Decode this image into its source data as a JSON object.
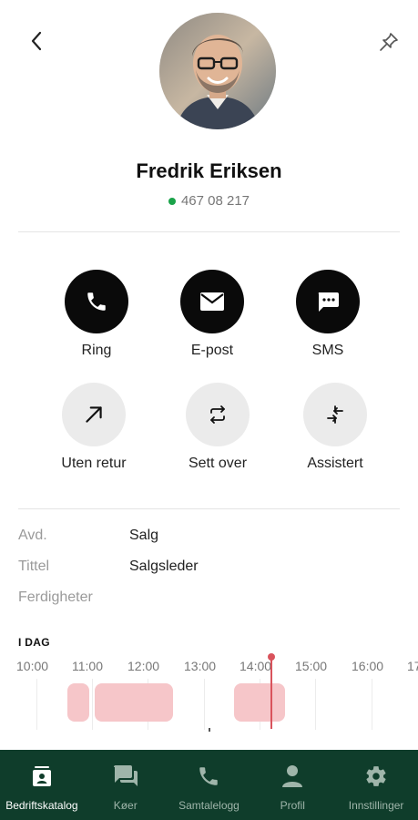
{
  "contact": {
    "name": "Fredrik Eriksen",
    "phone": "467 08 217",
    "status_color": "#1aa34a"
  },
  "actions_primary": [
    {
      "label": "Ring",
      "icon": "phone-icon"
    },
    {
      "label": "E-post",
      "icon": "mail-icon"
    },
    {
      "label": "SMS",
      "icon": "sms-icon"
    }
  ],
  "actions_transfer": [
    {
      "label": "Uten retur",
      "icon": "arrow-up-right-icon"
    },
    {
      "label": "Sett over",
      "icon": "swap-icon"
    },
    {
      "label": "Assistert",
      "icon": "assisted-transfer-icon"
    }
  ],
  "info": [
    {
      "key": "Avd.",
      "value": "Salg"
    },
    {
      "key": "Tittel",
      "value": "Salgsleder"
    },
    {
      "key": "Ferdigheter",
      "value": ""
    }
  ],
  "calendar": {
    "day_label": "I DAG",
    "hours": [
      "10:00",
      "11:00",
      "12:00",
      "13:00",
      "14:00",
      "15:00",
      "16:00",
      "17"
    ],
    "event_color": "#f6c6c9",
    "now_color": "#d9535c"
  },
  "nav": {
    "items": [
      {
        "label": "Bedriftskatalog",
        "icon": "directory-icon",
        "active": true
      },
      {
        "label": "Køer",
        "icon": "chat-icon",
        "active": false
      },
      {
        "label": "Samtalelogg",
        "icon": "phone-icon",
        "active": false
      },
      {
        "label": "Profil",
        "icon": "person-icon",
        "active": false
      },
      {
        "label": "Innstillinger",
        "icon": "gear-icon",
        "active": false
      }
    ],
    "background": "#0f3d2b"
  }
}
